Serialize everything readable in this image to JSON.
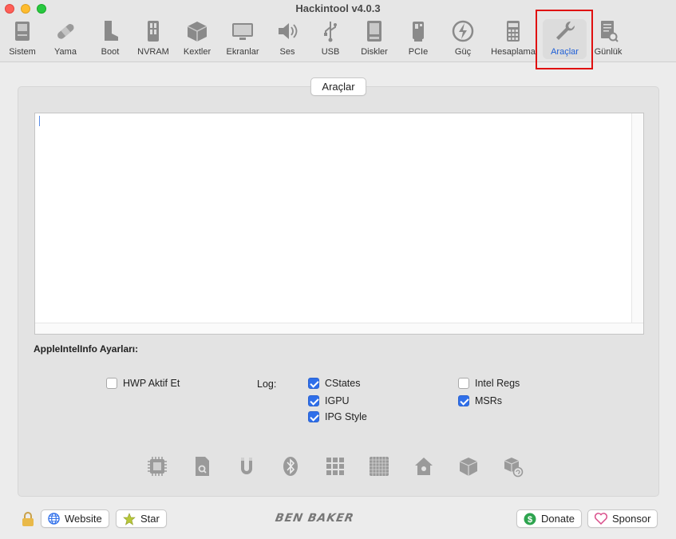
{
  "window": {
    "title": "Hackintool v4.0.3"
  },
  "toolbar": {
    "items": [
      {
        "label": "Sistem",
        "icon": "computer-icon"
      },
      {
        "label": "Yama",
        "icon": "bandage-icon"
      },
      {
        "label": "Boot",
        "icon": "boot-icon"
      },
      {
        "label": "NVRAM",
        "icon": "memory-chip-icon"
      },
      {
        "label": "Kextler",
        "icon": "package-icon"
      },
      {
        "label": "Ekranlar",
        "icon": "display-icon"
      },
      {
        "label": "Ses",
        "icon": "speaker-icon"
      },
      {
        "label": "USB",
        "icon": "usb-icon"
      },
      {
        "label": "Diskler",
        "icon": "disk-icon"
      },
      {
        "label": "PCIe",
        "icon": "pcie-card-icon"
      },
      {
        "label": "Güç",
        "icon": "power-bolt-icon"
      },
      {
        "label": "Hesaplama",
        "icon": "calculator-icon"
      },
      {
        "label": "Araçlar",
        "icon": "wrench-icon",
        "active": true
      },
      {
        "label": "Günlük",
        "icon": "log-document-icon"
      }
    ]
  },
  "main": {
    "tab_label": "Araçlar",
    "output_text": "",
    "section_title": "AppleIntelInfo Ayarları:",
    "hwp_label": "HWP Aktif Et",
    "hwp_checked": false,
    "log_label": "Log:",
    "log_options": [
      {
        "label": "CStates",
        "checked": true
      },
      {
        "label": "IGPU",
        "checked": true
      },
      {
        "label": "IPG Style",
        "checked": true
      },
      {
        "label": "Intel Regs",
        "checked": false
      },
      {
        "label": "MSRs",
        "checked": true
      }
    ],
    "tool_icons": [
      "cpu-chip-icon",
      "sd-card-icon",
      "magnet-icon",
      "bluetooth-icon",
      "grid-icon",
      "matrix-icon",
      "home-icon",
      "cube-icon",
      "cubes-refresh-icon"
    ]
  },
  "footer": {
    "website_label": "Website",
    "star_label": "Star",
    "brand": "BEN BAKER",
    "donate_label": "Donate",
    "sponsor_label": "Sponsor"
  },
  "colors": {
    "accent": "#2f6fea",
    "active_label": "#1f5fd6",
    "highlight": "#e01010"
  }
}
